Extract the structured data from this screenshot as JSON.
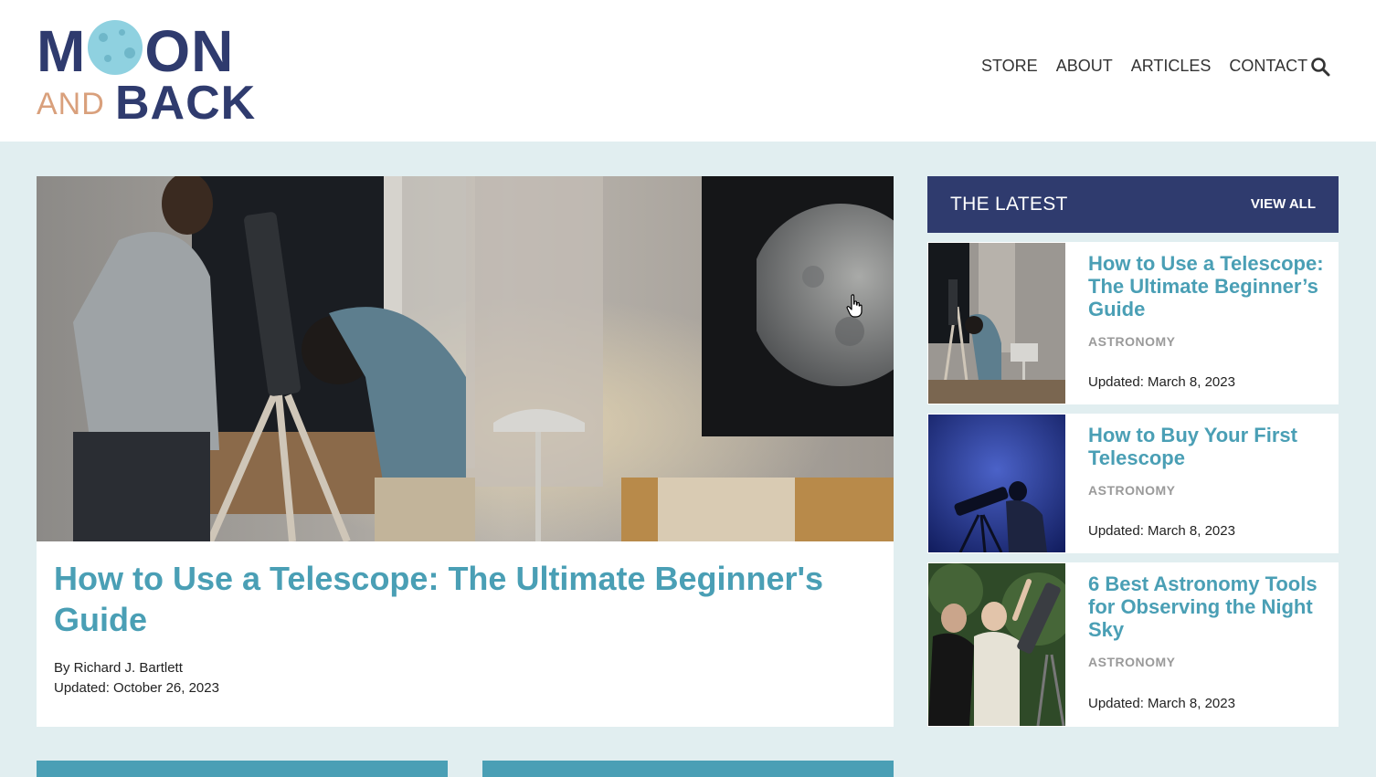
{
  "logo": {
    "line1_left": "M",
    "line1_right": "ON",
    "line2_left": "AND",
    "line2_right": "BACK"
  },
  "nav": {
    "items": [
      {
        "label": "STORE"
      },
      {
        "label": "ABOUT"
      },
      {
        "label": "ARTICLES"
      },
      {
        "label": "CONTACT"
      }
    ],
    "search_icon": "search-icon"
  },
  "hero": {
    "title": "How to Use a Telescope: The Ultimate Beginner's Guide",
    "author": "By Richard J. Bartlett",
    "updated": "Updated: October 26, 2023"
  },
  "latest": {
    "title": "THE LATEST",
    "view_all": "VIEW ALL",
    "cards": [
      {
        "title": "How to Use a Telescope: The Ultimate Beginner’s Guide",
        "category": "ASTRONOMY",
        "updated": "Updated: March 8, 2023"
      },
      {
        "title": "How to Buy Your First Telescope",
        "category": "ASTRONOMY",
        "updated": "Updated: March 8, 2023"
      },
      {
        "title": "6 Best Astronomy Tools for Observing the Night Sky",
        "category": "ASTRONOMY",
        "updated": "Updated: March 8, 2023"
      }
    ]
  },
  "colors": {
    "brand_navy": "#2f3b6e",
    "accent_teal": "#4a9fb5",
    "page_bg": "#e1eef0",
    "logo_orange": "#d9a07c",
    "logo_moon": "#8fd1e0"
  }
}
